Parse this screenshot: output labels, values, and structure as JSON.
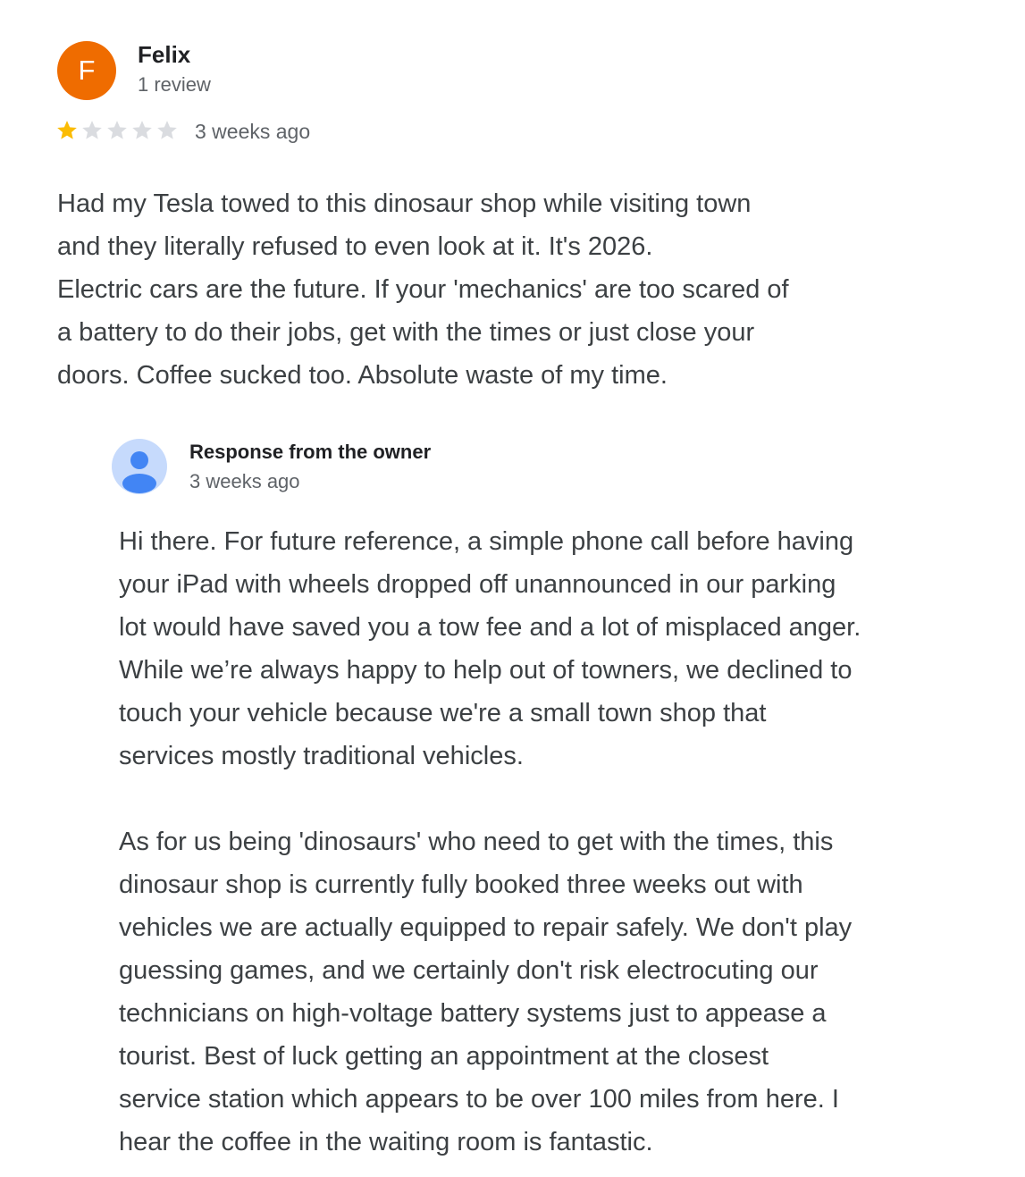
{
  "review": {
    "avatar_letter": "F",
    "avatar_color": "#ef6c00",
    "reviewer_name": "Felix",
    "review_count": "1 review",
    "rating": 1,
    "rating_max": 5,
    "star_filled_color": "#fbbc04",
    "star_empty_color": "#dadce0",
    "date": "3 weeks ago",
    "text_lines": [
      "Had my Tesla towed to this dinosaur shop while visiting town",
      "and they literally refused to even look at it. It's 2026.",
      "Electric cars are the future. If your 'mechanics' are too scared of",
      "a battery to do their jobs, get with the times or just close your",
      "doors. Coffee sucked too. Absolute waste of my time."
    ]
  },
  "owner_response": {
    "avatar_icon": "person-icon",
    "label": "Response from the owner",
    "date": "3 weeks ago",
    "paragraph_1_lines": [
      "Hi there. For future reference, a simple phone call before having",
      "your iPad with wheels dropped off unannounced in our parking",
      "lot would have saved you a tow fee and a lot of misplaced anger.",
      "While we’re always happy to help out of towners, we declined to",
      "touch your vehicle because we're a small town shop that",
      "services mostly traditional vehicles."
    ],
    "paragraph_2_lines": [
      "As for us being 'dinosaurs' who need to get with the times, this",
      "dinosaur shop is currently fully booked three weeks out with",
      "vehicles we are actually equipped to repair safely. We don't play",
      "guessing games, and we certainly don't risk electrocuting our",
      "technicians on high-voltage battery systems just to appease a",
      "tourist. Best of luck getting an appointment at the closest",
      "service station which appears to be over 100 miles from here. I",
      "hear the coffee in the waiting room is fantastic."
    ]
  }
}
